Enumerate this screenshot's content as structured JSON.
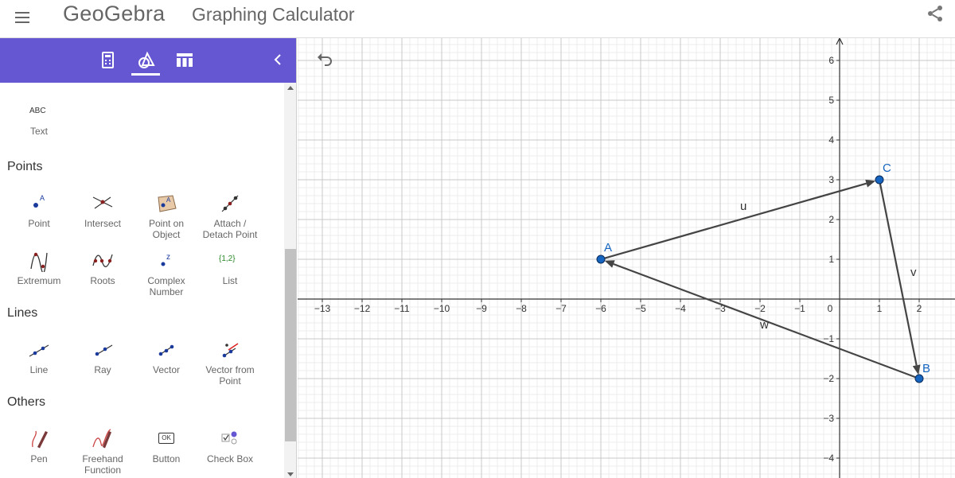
{
  "header": {
    "logo": "GeoGebra",
    "title": "Graphing Calculator",
    "menu_icon": "hamburger-icon",
    "share_icon": "share-icon"
  },
  "sidebar": {
    "tabs": [
      {
        "name": "algebra",
        "icon": "calculator-icon"
      },
      {
        "name": "tools",
        "icon": "tools-icon",
        "active": true
      },
      {
        "name": "table",
        "icon": "table-icon"
      }
    ],
    "collapse_icon": "chevron-left-icon",
    "accent_color": "#6557d2",
    "text_tool": {
      "icon_text": "ABC",
      "label": "Text"
    },
    "sections": [
      {
        "title": "Points",
        "tools": [
          {
            "label": "Point",
            "icon": "point-icon"
          },
          {
            "label": "Intersect",
            "icon": "intersect-icon"
          },
          {
            "label": "Point on Object",
            "icon": "point-on-object-icon"
          },
          {
            "label": "Attach / Detach Point",
            "icon": "attach-detach-icon"
          },
          {
            "label": "Extremum",
            "icon": "extremum-icon"
          },
          {
            "label": "Roots",
            "icon": "roots-icon"
          },
          {
            "label": "Complex Number",
            "icon": "complex-number-icon"
          },
          {
            "label": "List",
            "icon": "list-icon",
            "icon_text": "{1,2}"
          }
        ]
      },
      {
        "title": "Lines",
        "tools": [
          {
            "label": "Line",
            "icon": "line-icon"
          },
          {
            "label": "Ray",
            "icon": "ray-icon"
          },
          {
            "label": "Vector",
            "icon": "vector-icon"
          },
          {
            "label": "Vector from Point",
            "icon": "vector-from-point-icon"
          }
        ]
      },
      {
        "title": "Others",
        "tools": [
          {
            "label": "Pen",
            "icon": "pen-icon"
          },
          {
            "label": "Freehand Function",
            "icon": "freehand-icon"
          },
          {
            "label": "Button",
            "icon": "button-icon",
            "icon_text": "OK"
          },
          {
            "label": "Check Box",
            "icon": "checkbox-icon"
          }
        ]
      }
    ]
  },
  "graphics": {
    "undo_icon": "undo-icon",
    "x_range": [
      -13.4,
      2.9
    ],
    "y_range": [
      -4.5,
      6.6
    ],
    "x_ticks": [
      -13,
      -12,
      -11,
      -10,
      -9,
      -8,
      -7,
      -6,
      -5,
      -4,
      -3,
      -2,
      -1,
      1,
      2
    ],
    "y_ticks": [
      -4,
      -3,
      -2,
      -1,
      1,
      2,
      3,
      4,
      5,
      6
    ],
    "origin_label": "0",
    "points": [
      {
        "name": "A",
        "x": -6,
        "y": 1
      },
      {
        "name": "B",
        "x": 2,
        "y": -2
      },
      {
        "name": "C",
        "x": 1,
        "y": 3
      }
    ],
    "vectors": [
      {
        "name": "u",
        "from": "A",
        "to": "C"
      },
      {
        "name": "v",
        "from": "C",
        "to": "B"
      },
      {
        "name": "w",
        "from": "B",
        "to": "A"
      }
    ],
    "point_color": "#1565c0",
    "vector_color": "#444444",
    "grid": true
  }
}
